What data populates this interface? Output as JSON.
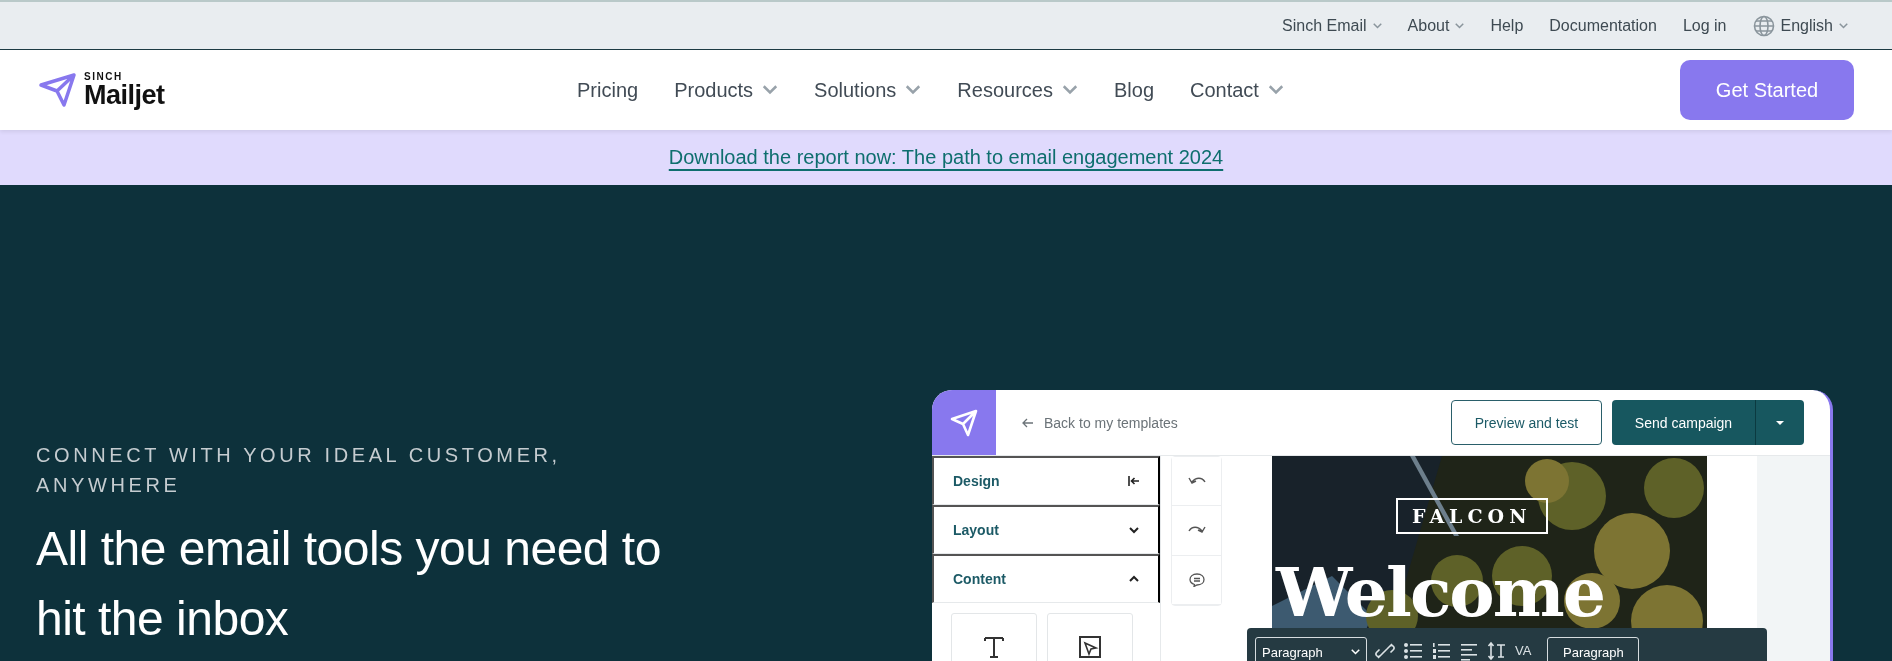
{
  "utility_nav": [
    {
      "label": "Sinch Email",
      "kind": "menu",
      "dropdown": true
    },
    {
      "label": "About",
      "kind": "menu",
      "dropdown": true
    },
    {
      "label": "Help",
      "kind": "link",
      "dropdown": false
    },
    {
      "label": "Documentation",
      "kind": "link",
      "dropdown": false
    },
    {
      "label": "Log in",
      "kind": "link",
      "dropdown": false
    },
    {
      "label": "English",
      "kind": "language",
      "dropdown": true
    }
  ],
  "header": {
    "logo_small": "SINCH",
    "logo": "Mailjet",
    "nav": [
      {
        "label": "Pricing",
        "dropdown": false
      },
      {
        "label": "Products",
        "dropdown": true
      },
      {
        "label": "Solutions",
        "dropdown": true
      },
      {
        "label": "Resources",
        "dropdown": true
      },
      {
        "label": "Blog",
        "dropdown": false
      },
      {
        "label": "Contact",
        "dropdown": true
      }
    ],
    "cta": "Get Started"
  },
  "banner": {
    "link": "Download the report now: The path to email engagement 2024"
  },
  "hero": {
    "eyebrow": "CONNECT WITH YOUR IDEAL CUSTOMER, ANYWHERE",
    "headline": "All the email tools you need to hit the inbox"
  },
  "mockup": {
    "back_link": "Back to my templates",
    "preview_button": "Preview and test",
    "send_button": "Send campaign",
    "panels": [
      {
        "label": "Design",
        "kind": "collapse"
      },
      {
        "label": "Layout",
        "kind": "section",
        "expanded": false
      },
      {
        "label": "Content",
        "kind": "section",
        "expanded": true
      }
    ],
    "email": {
      "brand": "FALCON",
      "title": "Welcome"
    },
    "toolbar": {
      "format_select": "Paragraph",
      "letter_spacing": "VA",
      "style_button": "Paragraph"
    }
  }
}
